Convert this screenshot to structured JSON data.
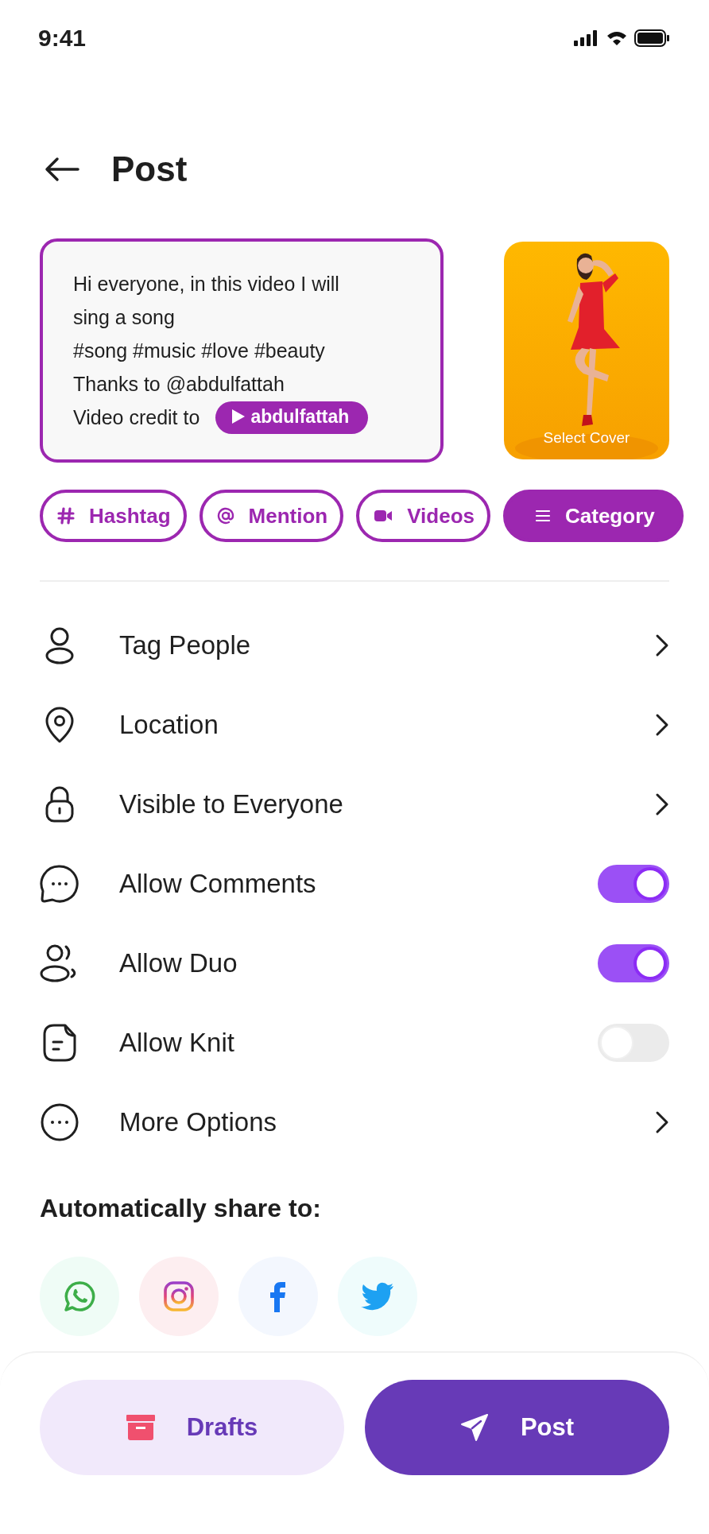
{
  "status_bar": {
    "time": "9:41"
  },
  "header": {
    "title": "Post"
  },
  "caption": {
    "text": "Hi everyone, in this video I will sing a song",
    "lines": [
      "#song #music #love #beauty",
      "Thanks to @abdulfattah"
    ],
    "credit_label": "Video credit to",
    "credit_tag": "abdulfattah"
  },
  "cover": {
    "label": "Select Cover"
  },
  "chips": [
    {
      "label": "Hashtag",
      "selected": false
    },
    {
      "label": "Mention",
      "selected": false
    },
    {
      "label": "Videos",
      "selected": false
    },
    {
      "label": "Category",
      "selected": true
    }
  ],
  "settings": [
    {
      "label": "Tag People",
      "kind": "link"
    },
    {
      "label": "Location",
      "kind": "link"
    },
    {
      "label": "Visible to Everyone",
      "kind": "link"
    },
    {
      "label": "Allow Comments",
      "kind": "toggle",
      "on": true
    },
    {
      "label": "Allow Duo",
      "kind": "toggle",
      "on": true
    },
    {
      "label": "Allow Knit",
      "kind": "toggle",
      "on": false
    },
    {
      "label": "More Options",
      "kind": "link"
    }
  ],
  "share": {
    "title": "Automatically share to:"
  },
  "buttons": [
    {
      "label": "Drafts",
      "kind": "secondary"
    },
    {
      "label": "Post",
      "kind": "primary"
    }
  ]
}
